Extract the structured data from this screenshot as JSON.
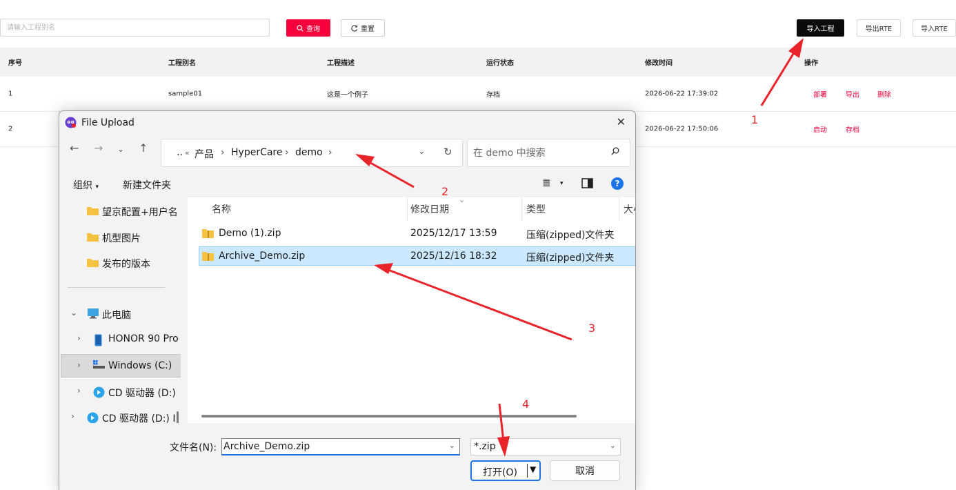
{
  "page": {
    "search_placeholder": "请输入工程别名",
    "query_label": "查询",
    "reset_label": "重置",
    "import_project_label": "导入工程",
    "export_rte_label": "导出RTE",
    "import_rte_label": "导入RTE",
    "columns": [
      "序号",
      "工程别名",
      "工程描述",
      "运行状态",
      "修改时间",
      "操作"
    ],
    "rows": [
      {
        "no": "1",
        "alias": "sample01",
        "desc": "这是一个例子",
        "status": "存档",
        "modified": "2026-06-22 17:39:02",
        "ops": [
          "部署",
          "导出",
          "删除"
        ]
      },
      {
        "no": "2",
        "alias": "",
        "desc": "",
        "status": "",
        "modified": "2026-06-22 17:50:06",
        "ops": [
          "启动",
          "存档"
        ]
      }
    ],
    "accent_color": "#f5003d"
  },
  "dialog": {
    "title": "File Upload",
    "breadcrumb": [
      "..",
      "«",
      "产品",
      "HyperCare",
      "demo"
    ],
    "search_placeholder": "在 demo 中搜索",
    "toolbar": {
      "organize": "组织",
      "new_folder": "新建文件夹"
    },
    "nav_items": [
      {
        "label": "望京配置+用户名"
      },
      {
        "label": "机型图片"
      },
      {
        "label": "发布的版本"
      },
      {
        "label": "此电脑"
      },
      {
        "label": "HONOR 90 Pro"
      },
      {
        "label": "Windows (C:)"
      },
      {
        "label": "CD 驱动器 (D:)"
      },
      {
        "label": "CD 驱动器 (D:) I"
      }
    ],
    "columns": {
      "name": "名称",
      "date": "修改日期",
      "type": "类型",
      "size": "大小"
    },
    "files": [
      {
        "name": "Demo (1).zip",
        "date": "2025/12/17 13:59",
        "type": "压缩(zipped)文件夹"
      },
      {
        "name": "Archive_Demo.zip",
        "date": "2025/12/16 18:32",
        "type": "压缩(zipped)文件夹"
      }
    ],
    "filename_label": "文件名(N):",
    "filename_value": "Archive_Demo.zip",
    "filter_value": "*.zip",
    "open_label": "打开(O)",
    "cancel_label": "取消"
  },
  "annotations": {
    "steps": [
      "1",
      "2",
      "3",
      "4"
    ],
    "color": "#e8242a"
  }
}
